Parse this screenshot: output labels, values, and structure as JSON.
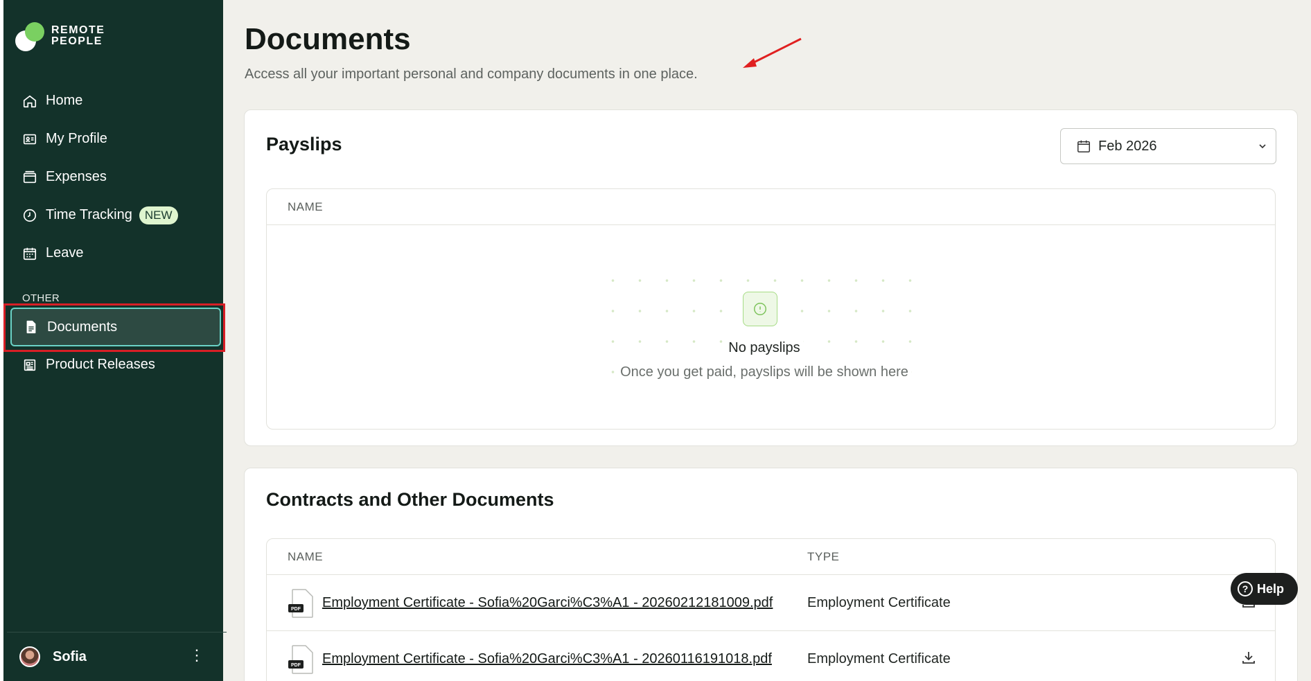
{
  "brand": {
    "line1": "REMOTE",
    "line2": "PEOPLE"
  },
  "sidebar": {
    "items": [
      {
        "label": "Home",
        "icon": "home-icon"
      },
      {
        "label": "My Profile",
        "icon": "id-card-icon"
      },
      {
        "label": "Expenses",
        "icon": "wallet-icon"
      },
      {
        "label": "Time Tracking",
        "icon": "clock-icon",
        "badge": "NEW"
      },
      {
        "label": "Leave",
        "icon": "calendar-icon"
      }
    ],
    "section_label": "OTHER",
    "active_item": {
      "label": "Documents",
      "icon": "document-icon"
    },
    "other_items": [
      {
        "label": "Product Releases",
        "icon": "newspaper-icon"
      }
    ],
    "user": {
      "name": "Sofia"
    }
  },
  "page": {
    "title": "Documents",
    "subtitle": "Access all your important personal and company documents in one place."
  },
  "payslips": {
    "title": "Payslips",
    "month_select": "Feb 2026",
    "column_name": "NAME",
    "empty_title": "No payslips",
    "empty_subtitle": "Once you get paid, payslips will be shown here"
  },
  "contracts": {
    "title": "Contracts and Other Documents",
    "column_name": "NAME",
    "column_type": "TYPE",
    "rows": [
      {
        "name": "Employment Certificate - Sofia%20Garci%C3%A1 - 20260212181009.pdf",
        "type": "Employment Certificate",
        "file_badge": "PDF"
      },
      {
        "name": "Employment Certificate - Sofia%20Garci%C3%A1 - 20260116191018.pdf",
        "type": "Employment Certificate",
        "file_badge": "PDF"
      }
    ]
  },
  "help_button": "Help",
  "colors": {
    "sidebar_bg": "#13322a",
    "accent_green": "#7ad061",
    "active_border": "#6ad2c6",
    "highlight_red": "#d81f26"
  }
}
